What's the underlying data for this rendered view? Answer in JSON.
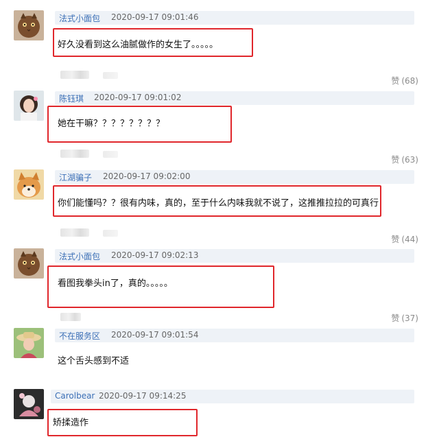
{
  "comments": [
    {
      "username": "法式小面包",
      "timestamp": "2020-09-17 09:01:46",
      "text": "好久没看到这么油腻做作的女生了。。。。。",
      "like_label": "赞",
      "like_count": "(68)",
      "avatar": "cat-avatar"
    },
    {
      "username": "陈钰琪",
      "timestamp": "2020-09-17 09:01:02",
      "text": "她在干嘛？？？？？？？？",
      "like_label": "赞",
      "like_count": "(63)",
      "avatar": "girl-avatar"
    },
    {
      "username": "江湖骗子",
      "timestamp": "2020-09-17 09:02:00",
      "text": "你们能懂吗？？很有内味，真的，至于什么内味我就不说了，这推推拉拉的可真行",
      "like_label": "赞",
      "like_count": "(44)",
      "avatar": "shiba-dog-avatar"
    },
    {
      "username": "法式小面包",
      "timestamp": "2020-09-17 09:02:13",
      "text": "看图我拳头in了，真的。。。。。",
      "like_label": "赞",
      "like_count": "(37)",
      "avatar": "cat-avatar"
    },
    {
      "username": "不在服务区",
      "timestamp": "2020-09-17 09:01:54",
      "text": "这个舌头感到不适",
      "avatar": "hat-woman-avatar"
    },
    {
      "username": "Carolbear",
      "timestamp": "2020-09-17 09:14:25",
      "text": "矫揉造作",
      "avatar": "pink-figure-avatar"
    }
  ],
  "colors": {
    "username": "#3b6fb6",
    "highlight_box": "#e0262b",
    "meta_bar": "#eef2f7"
  }
}
